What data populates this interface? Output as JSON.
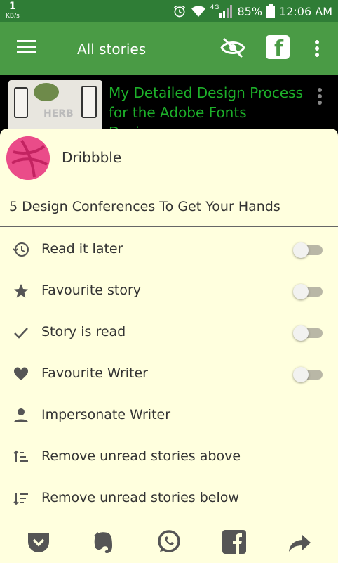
{
  "status": {
    "net_speed": "1",
    "net_unit": "KB/s",
    "battery": "85%",
    "time": "12:06 AM",
    "network_type": "4G"
  },
  "appbar": {
    "title": "All stories"
  },
  "story": {
    "headline": "My Detailed Design Process for the Adobe Fonts Design..."
  },
  "sheet": {
    "source": "Dribbble",
    "headline": "5 Design Conferences To Get Your Hands",
    "items": [
      {
        "label": "Read it later",
        "icon": "history-icon",
        "toggle": false
      },
      {
        "label": "Favourite story",
        "icon": "star-icon",
        "toggle": false
      },
      {
        "label": "Story is read",
        "icon": "check-icon",
        "toggle": false
      },
      {
        "label": "Favourite Writer",
        "icon": "heart-icon",
        "toggle": false
      },
      {
        "label": "Impersonate Writer",
        "icon": "person-icon"
      },
      {
        "label": "Remove unread stories above",
        "icon": "sort-ascending-icon"
      },
      {
        "label": "Remove unread stories below",
        "icon": "sort-descending-icon"
      }
    ]
  },
  "share_bar": [
    "pocket-icon",
    "evernote-icon",
    "whatsapp-icon",
    "facebook-icon",
    "share-icon"
  ],
  "colors": {
    "status_bar": "#2f7d36",
    "app_bar": "#4a9b45",
    "sheet_bg": "#ffffde",
    "headline_green": "#1db02a",
    "dribbble_pink": "#ea4c89"
  }
}
